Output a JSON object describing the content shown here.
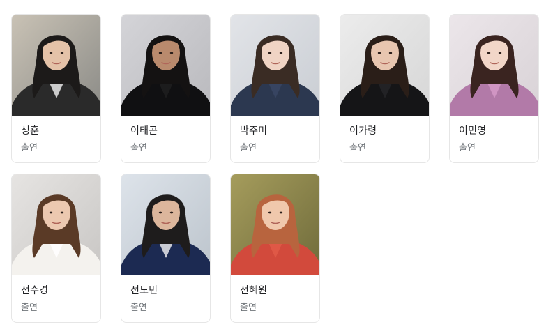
{
  "cast": [
    {
      "name": "성훈",
      "role": "출연",
      "bg": "#8a8a86",
      "bg2": "#c9c2b5",
      "hair": "#1c1a19",
      "skin": "#e4c2a8",
      "cloth": "#2a2a2a",
      "accent": "#e8e8e8"
    },
    {
      "name": "이태곤",
      "role": "출연",
      "bg": "#b9b9bd",
      "bg2": "#d4d4d8",
      "hair": "#141212",
      "skin": "#b98a6d",
      "cloth": "#101012",
      "accent": "#1e1e20"
    },
    {
      "name": "박주미",
      "role": "출연",
      "bg": "#c9cdd3",
      "bg2": "#e2e4e8",
      "hair": "#3a2c24",
      "skin": "#f0d4c4",
      "cloth": "#2c3850",
      "accent": "#3a4664"
    },
    {
      "name": "이가령",
      "role": "출연",
      "bg": "#d6d6d6",
      "bg2": "#ececec",
      "hair": "#2a1e18",
      "skin": "#e8c6b0",
      "cloth": "#151517",
      "accent": "#252528"
    },
    {
      "name": "이민영",
      "role": "출연",
      "bg": "#d8d2d6",
      "bg2": "#ece6ea",
      "hair": "#3a2420",
      "skin": "#f2d6c8",
      "cloth": "#b27aa8",
      "accent": "#d59ac8"
    },
    {
      "name": "전수경",
      "role": "출연",
      "bg": "#c8c6c4",
      "bg2": "#e6e4e2",
      "hair": "#5a3a26",
      "skin": "#ecc8b0",
      "cloth": "#f4f2ee",
      "accent": "#ffffff"
    },
    {
      "name": "전노민",
      "role": "출연",
      "bg": "#bcc4cc",
      "bg2": "#dde3ea",
      "hair": "#1e1c1c",
      "skin": "#dcb69c",
      "cloth": "#1c2a52",
      "accent": "#e6e6ea"
    },
    {
      "name": "전혜원",
      "role": "출연",
      "bg": "#6e6a3a",
      "bg2": "#a59c5c",
      "hair": "#b8643e",
      "skin": "#f0c8ac",
      "cloth": "#d24a3c",
      "accent": "#e25a48"
    }
  ]
}
